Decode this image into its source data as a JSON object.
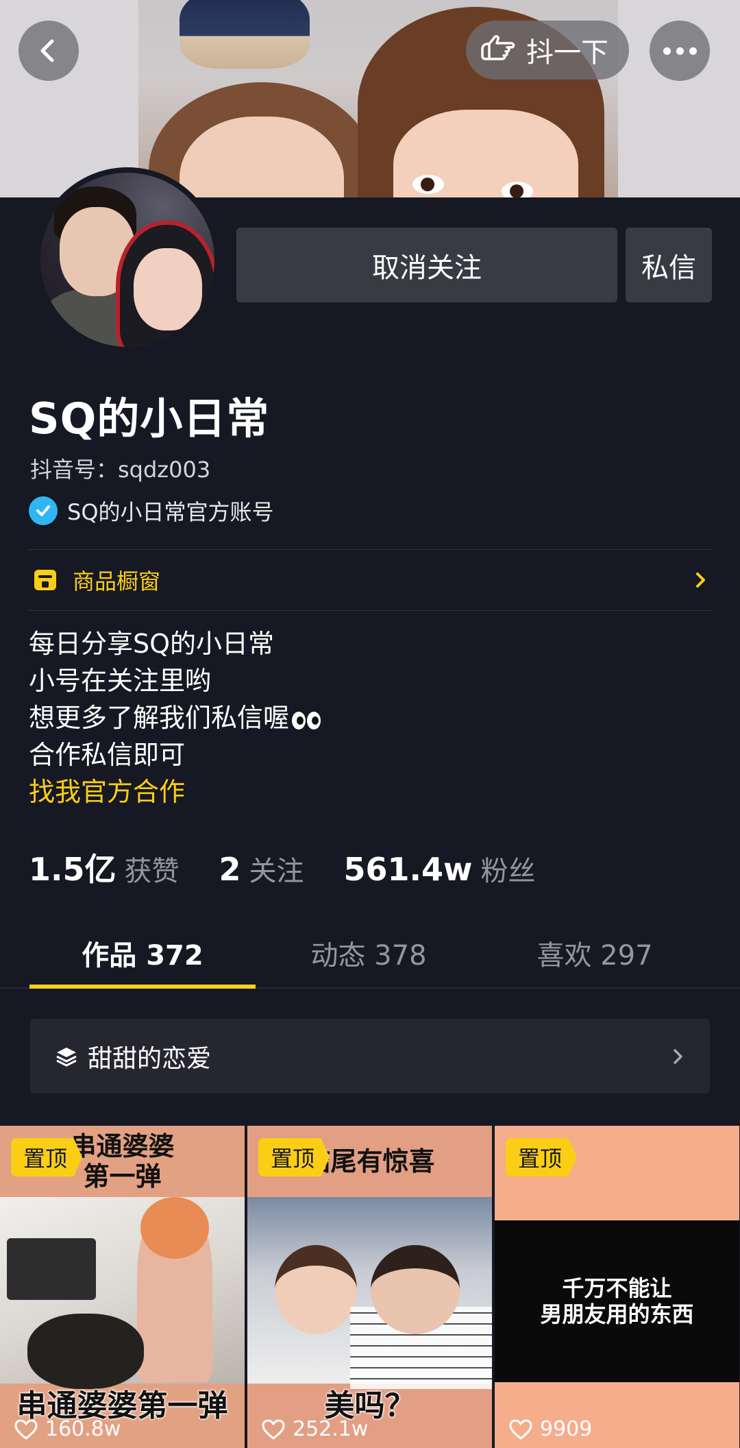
{
  "header": {
    "shake_label": "抖一下"
  },
  "actions": {
    "unfollow_label": "取消关注",
    "message_label": "私信"
  },
  "profile": {
    "nickname": "SQ的小日常",
    "douyin_id": "抖音号：sqdz003",
    "verified_text": "SQ的小日常官方账号"
  },
  "shop": {
    "label": "商品橱窗"
  },
  "bio": {
    "lines": [
      "每日分享SQ的小日常",
      "小号在关注里哟",
      "想更多了解我们私信喔",
      "合作私信即可"
    ],
    "link": "找我官方合作"
  },
  "stats": [
    {
      "value": "1.5亿",
      "label": "获赞"
    },
    {
      "value": "2",
      "label": "关注"
    },
    {
      "value": "561.4w",
      "label": "粉丝"
    }
  ],
  "tabs": [
    {
      "label": "作品 372",
      "active": true
    },
    {
      "label": "动态 378",
      "active": false
    },
    {
      "label": "喜欢 297",
      "active": false
    }
  ],
  "collection": {
    "label": "甜甜的恋爱"
  },
  "videos": [
    {
      "pin": "置顶",
      "top_title": "串通婆婆\n第一弹",
      "bottom_title": "串通婆婆第一弹",
      "likes": "160.8w"
    },
    {
      "pin": "置顶",
      "top_title": "结尾有惊喜",
      "bottom_title": "美吗？",
      "likes": "252.1w"
    },
    {
      "pin": "置顶",
      "center_text": "千万不能让\n男朋友用的东西",
      "likes": "9909"
    }
  ],
  "colors": {
    "background": "#161823",
    "accent_yellow": "#face15",
    "button_gray": "#393b44",
    "verified_blue": "#2fb6f5"
  },
  "icons": [
    "back-arrow-icon",
    "hand-pointer-icon",
    "more-dots-icon",
    "verified-check-icon",
    "shop-icon",
    "chevron-right-icon",
    "layers-icon",
    "heart-outline-icon"
  ]
}
